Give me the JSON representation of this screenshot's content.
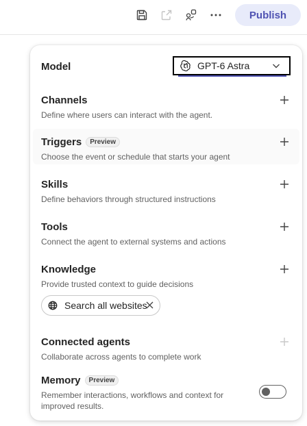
{
  "toolbar": {
    "save_icon": "save-icon",
    "share_icon": "share-icon",
    "connect_icon": "connect-icon",
    "more_icon": "more-icon",
    "publish_label": "Publish"
  },
  "model": {
    "label": "Model",
    "value": "GPT-6 Astra",
    "icon": "openai-icon"
  },
  "sections": {
    "channels": {
      "title": "Channels",
      "desc": "Define where users can interact with the agent."
    },
    "triggers": {
      "title": "Triggers",
      "badge": "Preview",
      "desc": "Choose the event or schedule that starts your agent"
    },
    "skills": {
      "title": "Skills",
      "desc": "Define behaviors through structured instructions"
    },
    "tools": {
      "title": "Tools",
      "desc": "Connect the agent to external systems and actions"
    },
    "knowledge": {
      "title": "Knowledge",
      "desc": "Provide trusted context to guide decisions"
    },
    "connected_agents": {
      "title": "Connected agents",
      "desc": "Collaborate across agents to complete work"
    },
    "memory": {
      "title": "Memory",
      "badge": "Preview",
      "desc": "Remember interactions, workflows and context for improved results."
    }
  },
  "knowledge_chip": {
    "label": "Search all websites"
  },
  "memory_toggle": {
    "on": false
  },
  "colors": {
    "accent": "#4f52b2",
    "publish_bg": "#e8ebfa"
  }
}
